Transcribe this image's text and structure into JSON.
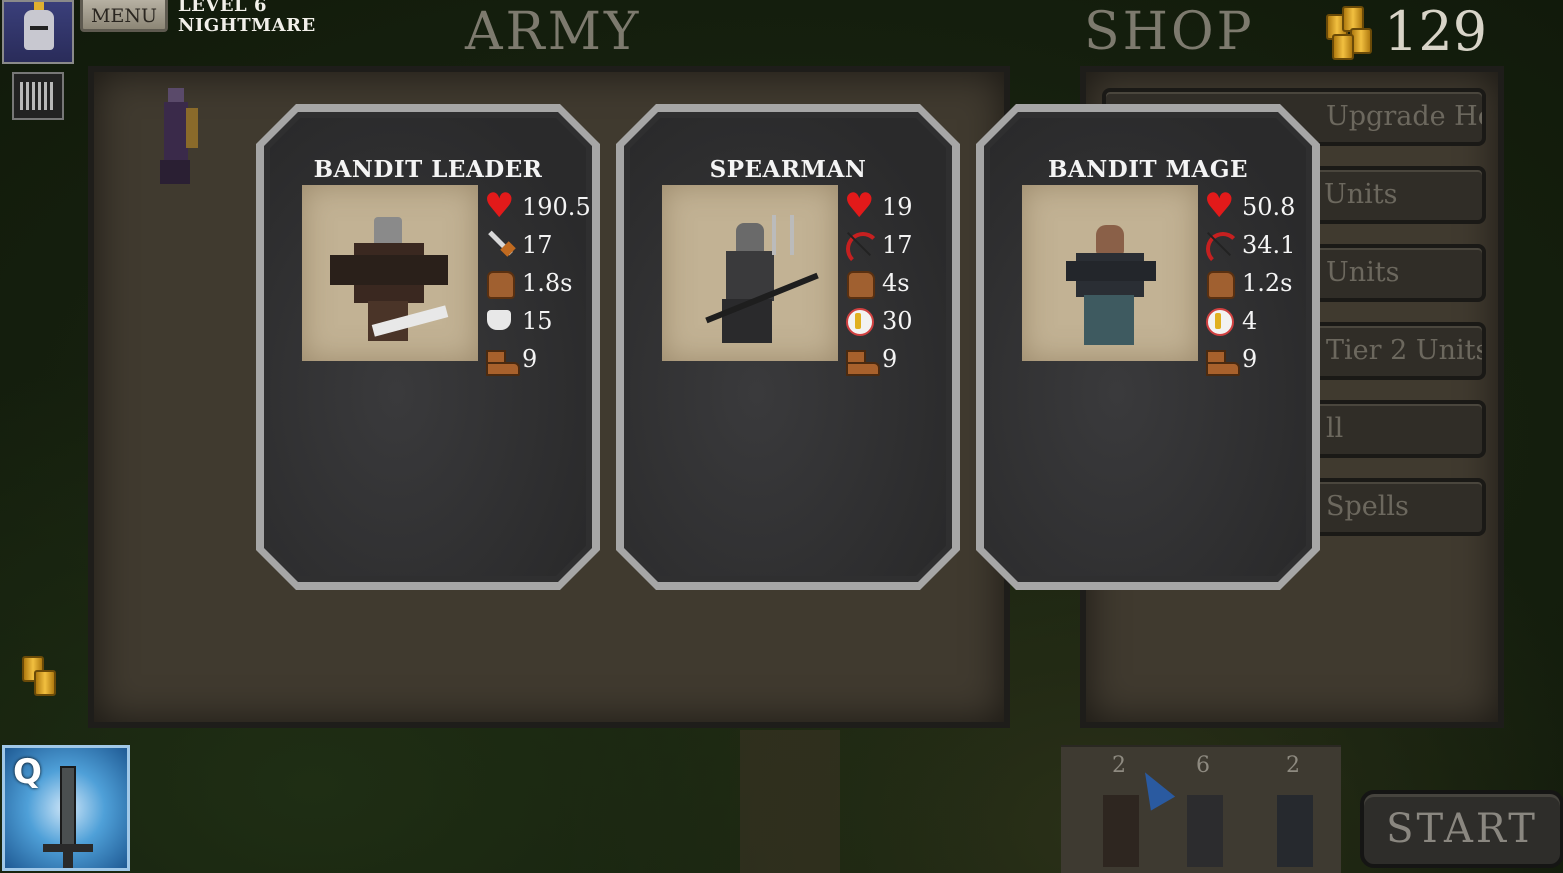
{
  "hud": {
    "menu_label": "MENU",
    "level_line1": "LEVEL 6",
    "level_line2": "NIGHTMARE",
    "army_title": "ARMY",
    "shop_title": "SHOP",
    "gold": "129"
  },
  "shop": {
    "buttons": [
      {
        "label": "Upgrade Hero"
      },
      {
        "label": "Units"
      },
      {
        "label": "Units"
      },
      {
        "label": "Tier 2 Units"
      },
      {
        "label": "ll"
      },
      {
        "label": "Spells"
      }
    ]
  },
  "cards": [
    {
      "name": "BANDIT LEADER",
      "stats": [
        {
          "icon": "heart-icon",
          "value": "190.5"
        },
        {
          "icon": "sword-icon",
          "value": "17"
        },
        {
          "icon": "fist-icon",
          "value": "1.8s"
        },
        {
          "icon": "armor-icon",
          "value": "15"
        },
        {
          "icon": "boot-icon",
          "value": "9"
        }
      ]
    },
    {
      "name": "SPEARMAN",
      "stats": [
        {
          "icon": "heart-icon",
          "value": "19"
        },
        {
          "icon": "bow-icon",
          "value": "17"
        },
        {
          "icon": "fist-icon",
          "value": "4s"
        },
        {
          "icon": "range-icon",
          "value": "30"
        },
        {
          "icon": "boot-icon",
          "value": "9"
        }
      ]
    },
    {
      "name": "BANDIT MAGE",
      "stats": [
        {
          "icon": "heart-icon",
          "value": "50.8"
        },
        {
          "icon": "bow-icon",
          "value": "34.1"
        },
        {
          "icon": "fist-icon",
          "value": "1.2s"
        },
        {
          "icon": "range-icon",
          "value": "4"
        },
        {
          "icon": "boot-icon",
          "value": "9"
        }
      ]
    }
  ],
  "deploy": {
    "counts": [
      "2",
      "6",
      "2"
    ]
  },
  "ability": {
    "hotkey": "Q"
  },
  "start_label": "START",
  "colors": {
    "heart": "#e21a1a",
    "gold": "#f2c040",
    "card_frame": "#a6a6a6"
  }
}
